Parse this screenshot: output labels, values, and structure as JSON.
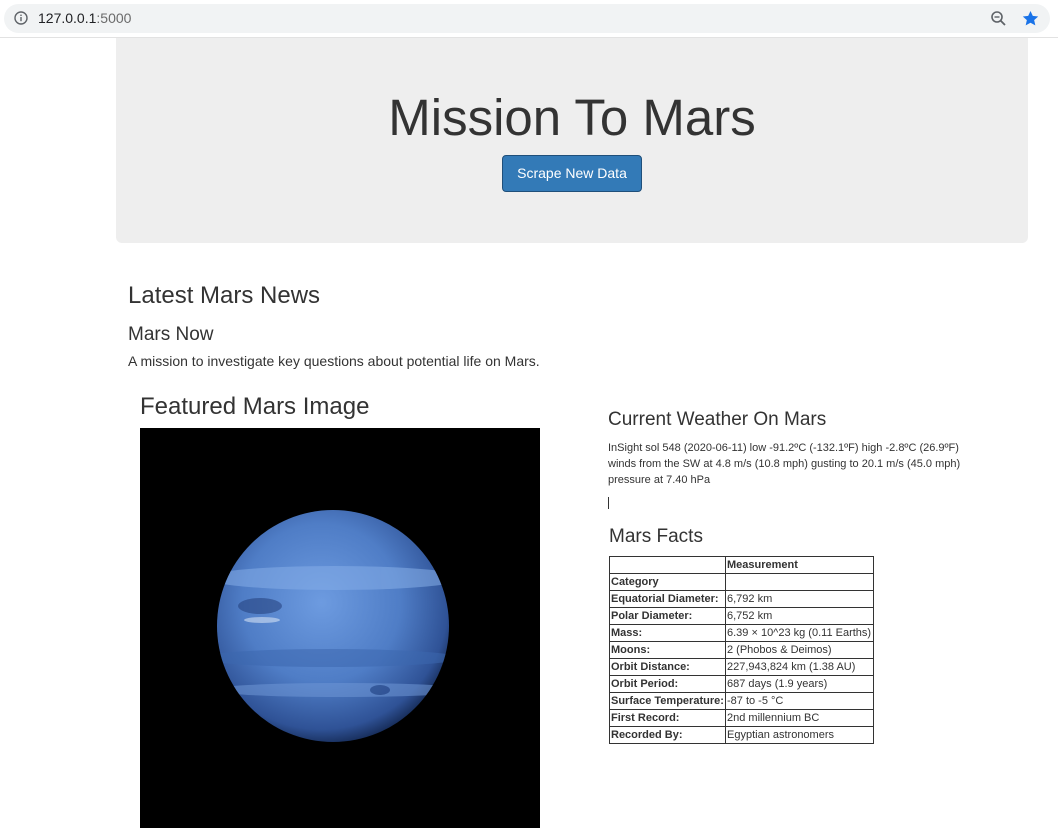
{
  "browser": {
    "url_host": "127.0.0.1",
    "url_port": ":5000"
  },
  "jumbotron": {
    "title": "Mission To Mars",
    "button_label": "Scrape New Data"
  },
  "news": {
    "heading": "Latest Mars News",
    "title": "Mars Now",
    "paragraph": "A mission to investigate key questions about potential life on Mars."
  },
  "featured_image": {
    "heading": "Featured Mars Image"
  },
  "weather": {
    "heading": "Current Weather On Mars",
    "text": "InSight sol 548 (2020-06-11) low -91.2ºC (-132.1ºF) high -2.8ºC (26.9ºF) winds from the SW at 4.8 m/s (10.8 mph) gusting to 20.1 m/s (45.0 mph) pressure at 7.40 hPa"
  },
  "facts": {
    "heading": "Mars Facts",
    "header_blank": "",
    "header_measurement": "Measurement",
    "index_label": "Category",
    "rows": [
      {
        "label": "Equatorial Diameter:",
        "value": "6,792 km"
      },
      {
        "label": "Polar Diameter:",
        "value": "6,752 km"
      },
      {
        "label": "Mass:",
        "value": "6.39 × 10^23 kg (0.11 Earths)"
      },
      {
        "label": "Moons:",
        "value": "2 (Phobos & Deimos)"
      },
      {
        "label": "Orbit Distance:",
        "value": "227,943,824 km (1.38 AU)"
      },
      {
        "label": "Orbit Period:",
        "value": "687 days (1.9 years)"
      },
      {
        "label": "Surface Temperature:",
        "value": "-87 to -5 °C"
      },
      {
        "label": "First Record:",
        "value": "2nd millennium BC"
      },
      {
        "label": "Recorded By:",
        "value": "Egyptian astronomers"
      }
    ]
  },
  "colors": {
    "button_primary": "#337ab7",
    "jumbotron_bg": "#eeeeee",
    "star_blue": "#1a73e8"
  }
}
